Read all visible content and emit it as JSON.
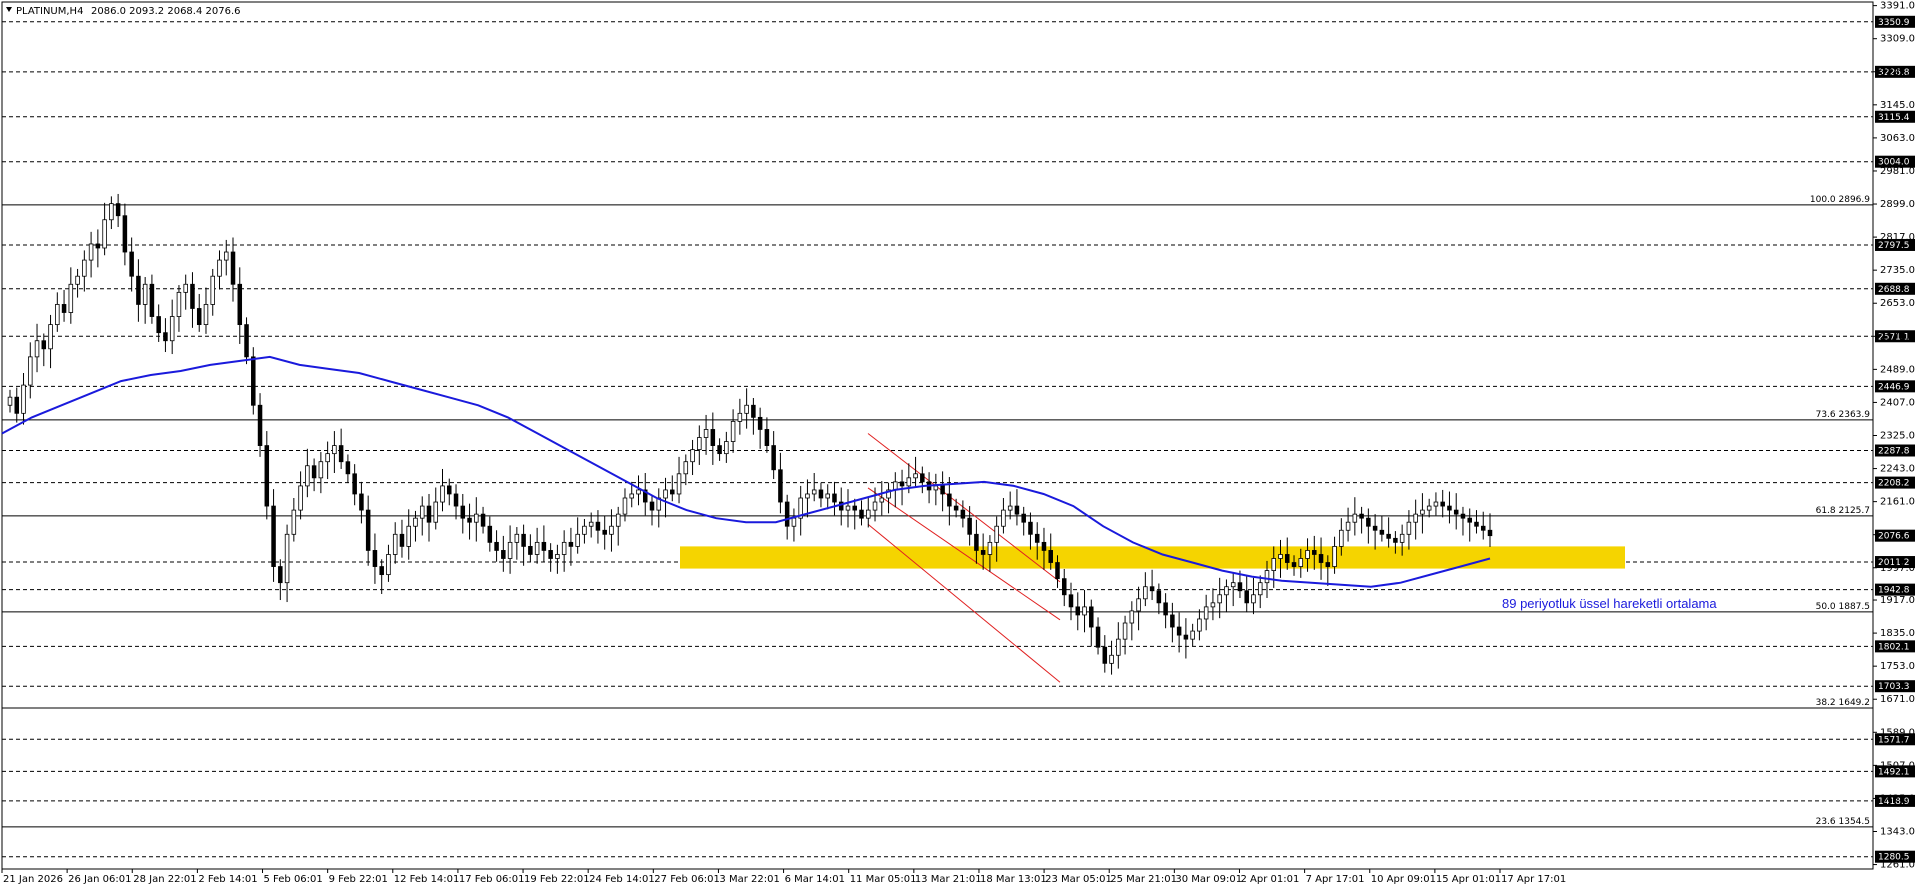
{
  "header": {
    "symbol": "PLATINUM,H4",
    "ohlc": "2086.0 2093.2 2068.4 2076.6"
  },
  "chart_data": {
    "type": "candlestick",
    "ylim": [
      1250,
      3400
    ],
    "y_ticks": [
      3391.0,
      3309.0,
      3227.0,
      3145.0,
      3063.0,
      2981.0,
      2899.0,
      2817.0,
      2735.0,
      2653.0,
      2571.0,
      2489.0,
      2407.0,
      2325.0,
      2243.0,
      2161.0,
      2079.0,
      1997.0,
      1917.0,
      1835.0,
      1753.0,
      1671.0,
      1589.0,
      1507.0,
      1425.0,
      1343.0,
      1261.0
    ],
    "x_labels": [
      "21 Jan 2026",
      "26 Jan 06:01",
      "28 Jan 22:01",
      "2 Feb 14:01",
      "5 Feb 06:01",
      "9 Feb 22:01",
      "12 Feb 14:01",
      "17 Feb 06:01",
      "19 Feb 22:01",
      "24 Feb 14:01",
      "27 Feb 06:01",
      "3 Mar 22:01",
      "6 Mar 14:01",
      "11 Mar 05:01",
      "13 Mar 21:01",
      "18 Mar 13:01",
      "23 Mar 05:01",
      "25 Mar 21:01",
      "30 Mar 09:01",
      "2 Apr 01:01",
      "7 Apr 17:01",
      "10 Apr 09:01",
      "15 Apr 01:01",
      "17 Apr 17:01"
    ],
    "current_price": 2076.6,
    "level_lines": [
      3350.9,
      3226.8,
      3115.4,
      3004.0,
      2797.5,
      2688.8,
      2571.1,
      2446.9,
      2287.8,
      2208.2,
      2011.2,
      1942.8,
      1802.1,
      1703.3,
      1571.7,
      1492.1,
      1418.9,
      1280.5
    ],
    "fibonacci": [
      {
        "label": "100.0 2896.9",
        "value": 2896.9
      },
      {
        "label": "73.6 2363.9",
        "value": 2363.9
      },
      {
        "label": "61.8 2125.7",
        "value": 2125.7
      },
      {
        "label": "50.0 1887.5",
        "value": 1887.5
      },
      {
        "label": "38.2 1649.2",
        "value": 1649.2
      },
      {
        "label": "23.6 1354.5",
        "value": 1354.5
      }
    ],
    "series": [
      {
        "name": "price",
        "close": [
          2420,
          2380,
          2450,
          2520,
          2560,
          2540,
          2600,
          2650,
          2630,
          2700,
          2720,
          2760,
          2800,
          2790,
          2860,
          2900,
          2870,
          2780,
          2720,
          2650,
          2700,
          2620,
          2580,
          2560,
          2620,
          2680,
          2700,
          2640,
          2600,
          2650,
          2720,
          2760,
          2780,
          2700,
          2600,
          2520,
          2400,
          2300,
          2150,
          2000,
          1960,
          2080,
          2140,
          2200,
          2250,
          2220,
          2260,
          2280,
          2300,
          2260,
          2230,
          2180,
          2140,
          2040,
          2000,
          1980,
          2030,
          2080,
          2050,
          2100,
          2120,
          2150,
          2110,
          2160,
          2200,
          2180,
          2150,
          2120,
          2110,
          2130,
          2100,
          2060,
          2040,
          2020,
          2060,
          2080,
          2050,
          2030,
          2060,
          2040,
          2020,
          2030,
          2060,
          2050,
          2080,
          2100,
          2110,
          2090,
          2080,
          2100,
          2130,
          2170,
          2180,
          2190,
          2160,
          2140,
          2170,
          2190,
          2180,
          2230,
          2260,
          2290,
          2320,
          2340,
          2300,
          2280,
          2310,
          2360,
          2380,
          2400,
          2370,
          2340,
          2300,
          2240,
          2160,
          2100,
          2120,
          2170,
          2180,
          2190,
          2170,
          2180,
          2160,
          2140,
          2150,
          2140,
          2120,
          2140,
          2160,
          2170,
          2190,
          2210,
          2200,
          2220,
          2230,
          2210,
          2190,
          2200,
          2180,
          2150,
          2140,
          2120,
          2080,
          2040,
          2030,
          2060,
          2100,
          2140,
          2150,
          2130,
          2110,
          2080,
          2060,
          2040,
          2010,
          1970,
          1930,
          1900,
          1880,
          1900,
          1850,
          1800,
          1760,
          1780,
          1820,
          1860,
          1890,
          1920,
          1950,
          1940,
          1910,
          1880,
          1850,
          1830,
          1820,
          1840,
          1870,
          1900,
          1910,
          1930,
          1950,
          1960,
          1940,
          1910,
          1930,
          1960,
          1990,
          2020,
          2030,
          2010,
          2000,
          2020,
          2040,
          2030,
          2010,
          2000,
          2050,
          2090,
          2110,
          2130,
          2120,
          2100,
          2090,
          2080,
          2070,
          2060,
          2080,
          2110,
          2130,
          2140,
          2150,
          2160,
          2150,
          2140,
          2130,
          2120,
          2110,
          2100,
          2090,
          2076.6
        ]
      },
      {
        "name": "89 periyotluk üssel hareketli ortalama",
        "ema": [
          2330,
          2370,
          2400,
          2430,
          2460,
          2475,
          2485,
          2500,
          2510,
          2520,
          2500,
          2490,
          2480,
          2460,
          2440,
          2420,
          2400,
          2370,
          2330,
          2290,
          2250,
          2210,
          2170,
          2140,
          2120,
          2110,
          2110,
          2130,
          2150,
          2170,
          2190,
          2200,
          2205,
          2210,
          2200,
          2180,
          2150,
          2100,
          2060,
          2030,
          2010,
          1990,
          1975,
          1965,
          1960,
          1955,
          1950,
          1960,
          1980,
          2000,
          2020
        ]
      }
    ]
  },
  "annotations": {
    "ema_label": "89 periyotluk üssel hareketli ortalama"
  },
  "colors": {
    "background": "#ffffff",
    "ema": "#1a1adc",
    "zone": "#f5d400",
    "channel": "#e02020",
    "level_tag": "#000000"
  }
}
